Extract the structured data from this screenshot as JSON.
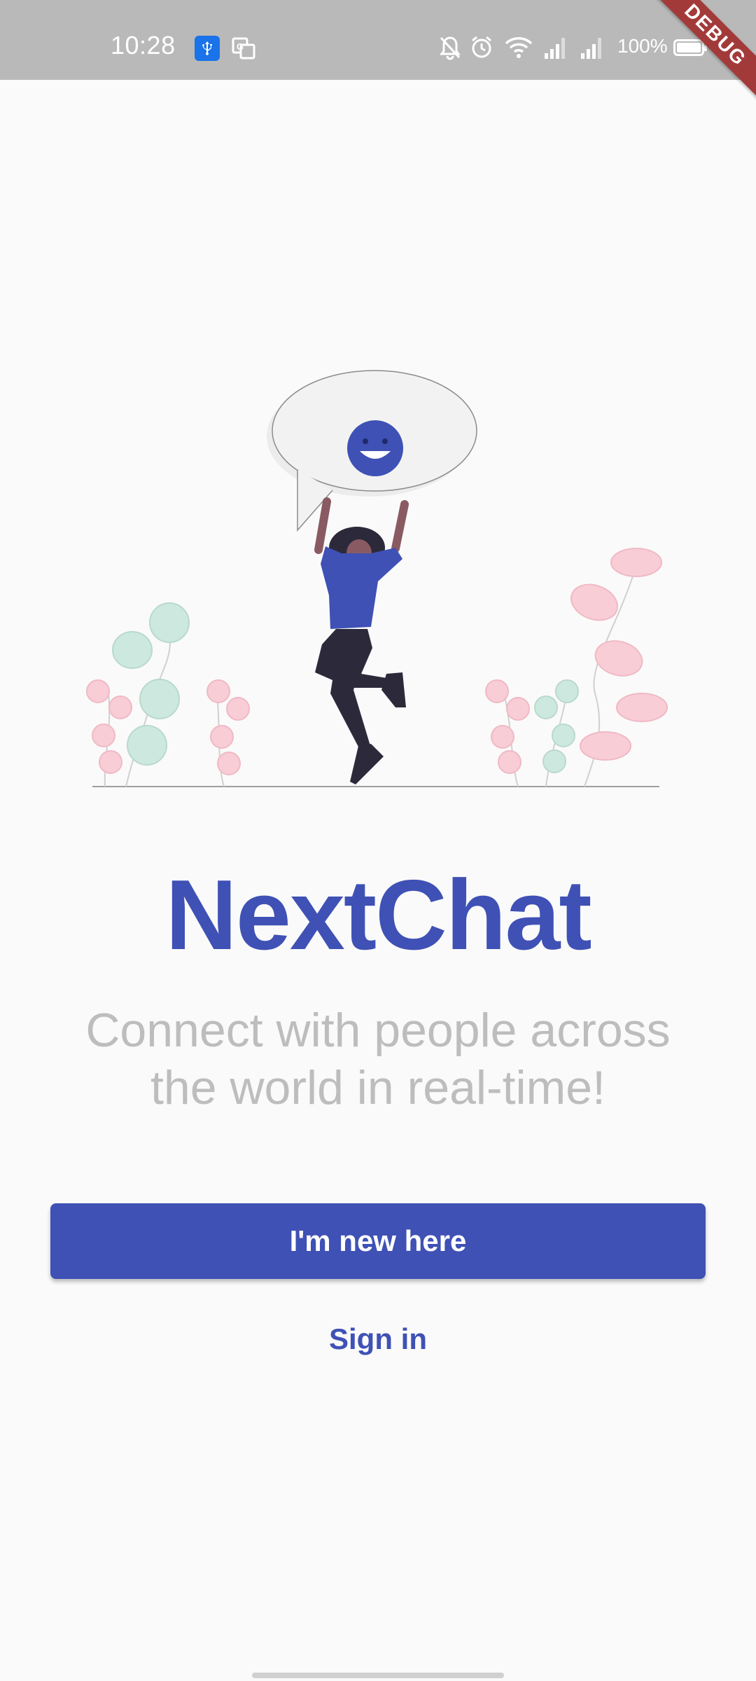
{
  "status_bar": {
    "time": "10:28",
    "battery": "100%",
    "icons": [
      "usb-icon",
      "translate-icon",
      "bell-off-icon",
      "alarm-icon",
      "wifi-icon",
      "signal-icon",
      "signal-icon",
      "battery-icon"
    ]
  },
  "debug_banner": "DEBUG",
  "welcome": {
    "title": "NextChat",
    "tagline_line1": "Connect with people across",
    "tagline_line2": "the world in real-time!",
    "primary_button": "I'm new here",
    "secondary_link": "Sign in"
  },
  "colors": {
    "brand": "#3f51b5",
    "tagline": "#bdbdbd",
    "background": "#fafafa",
    "status_bar": "#b9b9b9",
    "debug": "#a33a3a"
  }
}
